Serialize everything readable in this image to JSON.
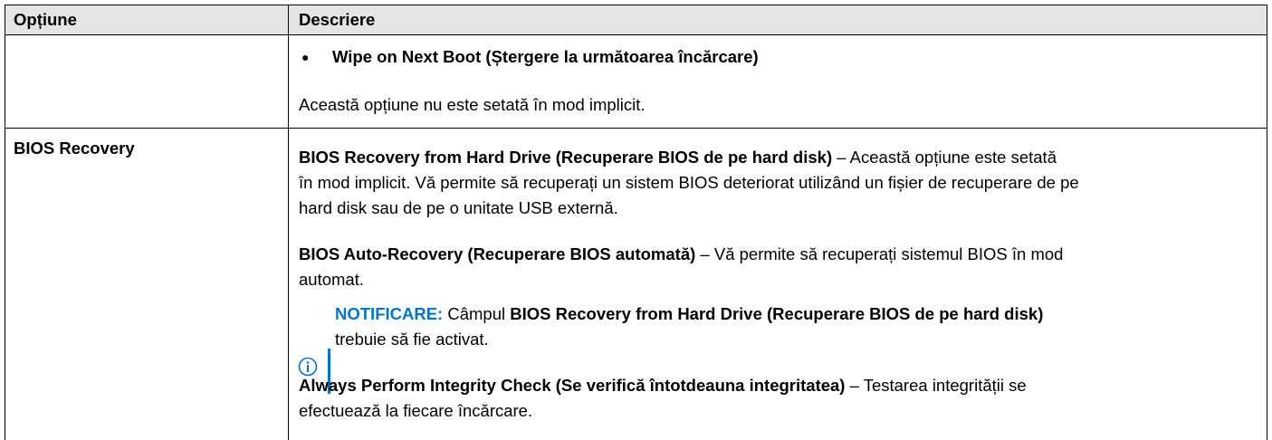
{
  "table": {
    "headers": {
      "option": "Opțiune",
      "description": "Descriere"
    },
    "rows": [
      {
        "option": "",
        "bullet_item": "Wipe on Next Boot (Ștergere la următoarea încărcare)",
        "text": "Această opțiune nu este setată în mod implicit."
      },
      {
        "option": "BIOS Recovery",
        "p1": {
          "bold": "BIOS Recovery from Hard Drive (Recuperare BIOS de pe hard disk)",
          "line1": " – Această opțiune este setată",
          "line2": "în mod implicit. Vă permite să recuperați un sistem BIOS deteriorat utilizând un fișier de recuperare de pe",
          "line3": "hard disk sau de pe o unitate USB externă."
        },
        "p2": {
          "bold": "BIOS Auto-Recovery (Recuperare BIOS automată)",
          "line1": " – Vă permite să recuperați sistemul BIOS în mod",
          "line2": "automat."
        },
        "note": {
          "label": "NOTIFICARE:",
          "pre": " Câmpul ",
          "bold": "BIOS Recovery from Hard Drive (Recuperare BIOS de pe hard disk)",
          "line2": "trebuie să fie activat.",
          "icon": "info-circle-icon",
          "accent": "#0076ce"
        },
        "p3": {
          "bold": "Always Perform Integrity Check (Se verifică întotdeauna integritatea)",
          "line1": " – Testarea integrității se",
          "line2": "efectuează la fiecare încărcare."
        }
      }
    ]
  }
}
